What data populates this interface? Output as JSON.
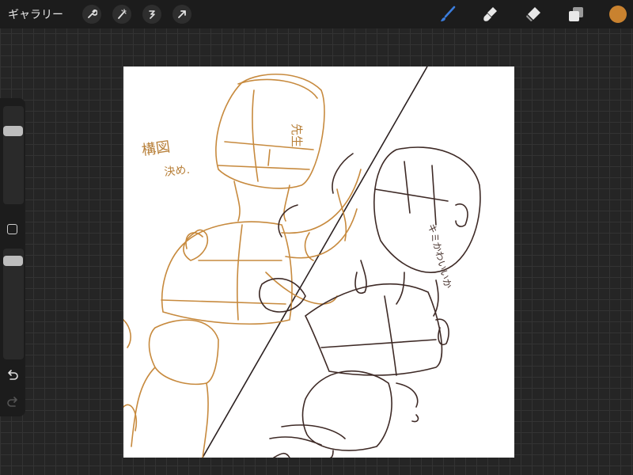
{
  "topbar": {
    "gallery_label": "ギャラリー",
    "tools": [
      {
        "icon": "wrench-icon"
      },
      {
        "icon": "magic-wand-icon"
      },
      {
        "icon": "selection-icon"
      },
      {
        "icon": "transform-arrow-icon"
      }
    ],
    "right_tools": [
      {
        "icon": "brush-icon",
        "active": true
      },
      {
        "icon": "smudge-icon"
      },
      {
        "icon": "eraser-icon"
      },
      {
        "icon": "layers-icon"
      }
    ],
    "current_color": "#c9822f",
    "active_tool_color": "#3b7ddd"
  },
  "sidebar": {
    "brush_size_value": 0.2,
    "opacity_value": 0.35
  },
  "canvas": {
    "annotations": [
      {
        "text": "先生",
        "color": "#b8803a"
      },
      {
        "text": "構図",
        "color": "#b8803a"
      },
      {
        "text": "決め.",
        "color": "#b8803a"
      },
      {
        "text": "キミかわいいか",
        "color": "#4a3530"
      }
    ],
    "sketch_colors": {
      "orange": "#c78a3e",
      "dark": "#3e2a26"
    }
  }
}
